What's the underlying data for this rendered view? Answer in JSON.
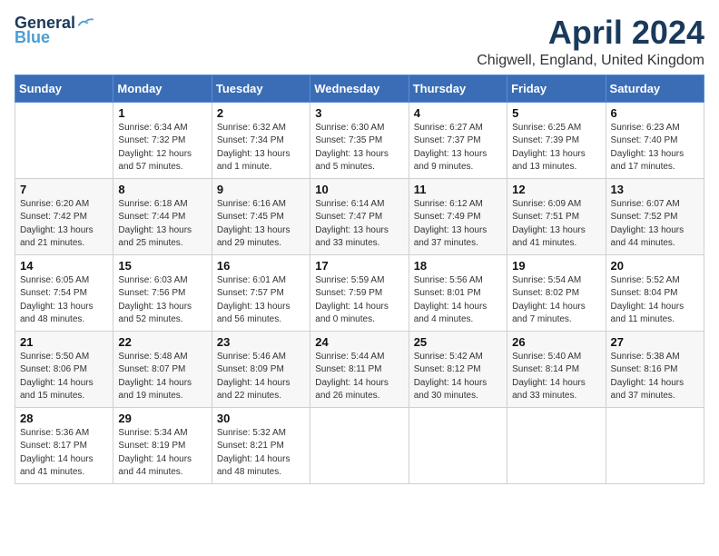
{
  "header": {
    "logo_line1": "General",
    "logo_line2": "Blue",
    "title": "April 2024",
    "subtitle": "Chigwell, England, United Kingdom"
  },
  "columns": [
    "Sunday",
    "Monday",
    "Tuesday",
    "Wednesday",
    "Thursday",
    "Friday",
    "Saturday"
  ],
  "weeks": [
    [
      {
        "day": "",
        "sunrise": "",
        "sunset": "",
        "daylight": ""
      },
      {
        "day": "1",
        "sunrise": "Sunrise: 6:34 AM",
        "sunset": "Sunset: 7:32 PM",
        "daylight": "Daylight: 12 hours and 57 minutes."
      },
      {
        "day": "2",
        "sunrise": "Sunrise: 6:32 AM",
        "sunset": "Sunset: 7:34 PM",
        "daylight": "Daylight: 13 hours and 1 minute."
      },
      {
        "day": "3",
        "sunrise": "Sunrise: 6:30 AM",
        "sunset": "Sunset: 7:35 PM",
        "daylight": "Daylight: 13 hours and 5 minutes."
      },
      {
        "day": "4",
        "sunrise": "Sunrise: 6:27 AM",
        "sunset": "Sunset: 7:37 PM",
        "daylight": "Daylight: 13 hours and 9 minutes."
      },
      {
        "day": "5",
        "sunrise": "Sunrise: 6:25 AM",
        "sunset": "Sunset: 7:39 PM",
        "daylight": "Daylight: 13 hours and 13 minutes."
      },
      {
        "day": "6",
        "sunrise": "Sunrise: 6:23 AM",
        "sunset": "Sunset: 7:40 PM",
        "daylight": "Daylight: 13 hours and 17 minutes."
      }
    ],
    [
      {
        "day": "7",
        "sunrise": "Sunrise: 6:20 AM",
        "sunset": "Sunset: 7:42 PM",
        "daylight": "Daylight: 13 hours and 21 minutes."
      },
      {
        "day": "8",
        "sunrise": "Sunrise: 6:18 AM",
        "sunset": "Sunset: 7:44 PM",
        "daylight": "Daylight: 13 hours and 25 minutes."
      },
      {
        "day": "9",
        "sunrise": "Sunrise: 6:16 AM",
        "sunset": "Sunset: 7:45 PM",
        "daylight": "Daylight: 13 hours and 29 minutes."
      },
      {
        "day": "10",
        "sunrise": "Sunrise: 6:14 AM",
        "sunset": "Sunset: 7:47 PM",
        "daylight": "Daylight: 13 hours and 33 minutes."
      },
      {
        "day": "11",
        "sunrise": "Sunrise: 6:12 AM",
        "sunset": "Sunset: 7:49 PM",
        "daylight": "Daylight: 13 hours and 37 minutes."
      },
      {
        "day": "12",
        "sunrise": "Sunrise: 6:09 AM",
        "sunset": "Sunset: 7:51 PM",
        "daylight": "Daylight: 13 hours and 41 minutes."
      },
      {
        "day": "13",
        "sunrise": "Sunrise: 6:07 AM",
        "sunset": "Sunset: 7:52 PM",
        "daylight": "Daylight: 13 hours and 44 minutes."
      }
    ],
    [
      {
        "day": "14",
        "sunrise": "Sunrise: 6:05 AM",
        "sunset": "Sunset: 7:54 PM",
        "daylight": "Daylight: 13 hours and 48 minutes."
      },
      {
        "day": "15",
        "sunrise": "Sunrise: 6:03 AM",
        "sunset": "Sunset: 7:56 PM",
        "daylight": "Daylight: 13 hours and 52 minutes."
      },
      {
        "day": "16",
        "sunrise": "Sunrise: 6:01 AM",
        "sunset": "Sunset: 7:57 PM",
        "daylight": "Daylight: 13 hours and 56 minutes."
      },
      {
        "day": "17",
        "sunrise": "Sunrise: 5:59 AM",
        "sunset": "Sunset: 7:59 PM",
        "daylight": "Daylight: 14 hours and 0 minutes."
      },
      {
        "day": "18",
        "sunrise": "Sunrise: 5:56 AM",
        "sunset": "Sunset: 8:01 PM",
        "daylight": "Daylight: 14 hours and 4 minutes."
      },
      {
        "day": "19",
        "sunrise": "Sunrise: 5:54 AM",
        "sunset": "Sunset: 8:02 PM",
        "daylight": "Daylight: 14 hours and 7 minutes."
      },
      {
        "day": "20",
        "sunrise": "Sunrise: 5:52 AM",
        "sunset": "Sunset: 8:04 PM",
        "daylight": "Daylight: 14 hours and 11 minutes."
      }
    ],
    [
      {
        "day": "21",
        "sunrise": "Sunrise: 5:50 AM",
        "sunset": "Sunset: 8:06 PM",
        "daylight": "Daylight: 14 hours and 15 minutes."
      },
      {
        "day": "22",
        "sunrise": "Sunrise: 5:48 AM",
        "sunset": "Sunset: 8:07 PM",
        "daylight": "Daylight: 14 hours and 19 minutes."
      },
      {
        "day": "23",
        "sunrise": "Sunrise: 5:46 AM",
        "sunset": "Sunset: 8:09 PM",
        "daylight": "Daylight: 14 hours and 22 minutes."
      },
      {
        "day": "24",
        "sunrise": "Sunrise: 5:44 AM",
        "sunset": "Sunset: 8:11 PM",
        "daylight": "Daylight: 14 hours and 26 minutes."
      },
      {
        "day": "25",
        "sunrise": "Sunrise: 5:42 AM",
        "sunset": "Sunset: 8:12 PM",
        "daylight": "Daylight: 14 hours and 30 minutes."
      },
      {
        "day": "26",
        "sunrise": "Sunrise: 5:40 AM",
        "sunset": "Sunset: 8:14 PM",
        "daylight": "Daylight: 14 hours and 33 minutes."
      },
      {
        "day": "27",
        "sunrise": "Sunrise: 5:38 AM",
        "sunset": "Sunset: 8:16 PM",
        "daylight": "Daylight: 14 hours and 37 minutes."
      }
    ],
    [
      {
        "day": "28",
        "sunrise": "Sunrise: 5:36 AM",
        "sunset": "Sunset: 8:17 PM",
        "daylight": "Daylight: 14 hours and 41 minutes."
      },
      {
        "day": "29",
        "sunrise": "Sunrise: 5:34 AM",
        "sunset": "Sunset: 8:19 PM",
        "daylight": "Daylight: 14 hours and 44 minutes."
      },
      {
        "day": "30",
        "sunrise": "Sunrise: 5:32 AM",
        "sunset": "Sunset: 8:21 PM",
        "daylight": "Daylight: 14 hours and 48 minutes."
      },
      {
        "day": "",
        "sunrise": "",
        "sunset": "",
        "daylight": ""
      },
      {
        "day": "",
        "sunrise": "",
        "sunset": "",
        "daylight": ""
      },
      {
        "day": "",
        "sunrise": "",
        "sunset": "",
        "daylight": ""
      },
      {
        "day": "",
        "sunrise": "",
        "sunset": "",
        "daylight": ""
      }
    ]
  ]
}
